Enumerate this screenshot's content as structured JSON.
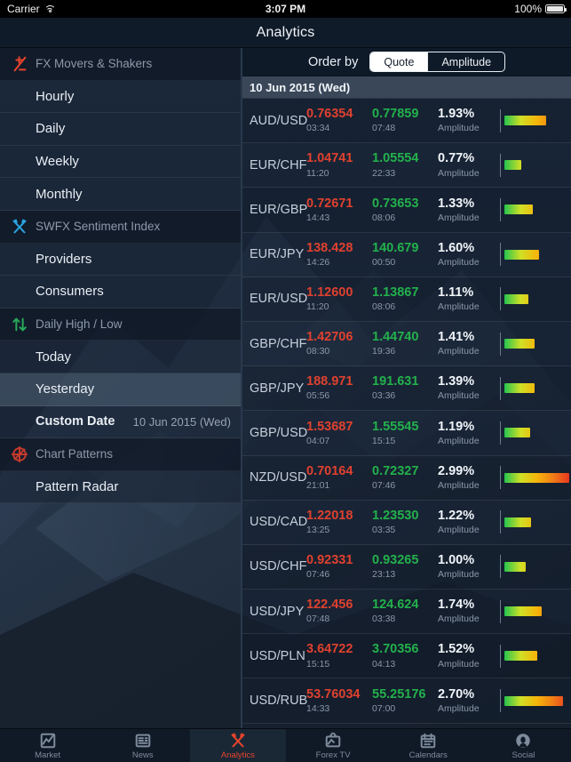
{
  "status_bar": {
    "carrier": "Carrier",
    "wifi_icon": "wifi-icon",
    "time": "3:07 PM",
    "battery_percent": "100%",
    "battery_icon": "battery-full-icon"
  },
  "navbar": {
    "title": "Analytics"
  },
  "sidebar": {
    "sections": [
      {
        "icon": "plus-minus-icon",
        "icon_color": "#e8442c",
        "label": "FX Movers & Shakers",
        "items": [
          {
            "label": "Hourly",
            "selected": false,
            "detail": ""
          },
          {
            "label": "Daily",
            "selected": false,
            "detail": ""
          },
          {
            "label": "Weekly",
            "selected": false,
            "detail": ""
          },
          {
            "label": "Monthly",
            "selected": false,
            "detail": ""
          }
        ]
      },
      {
        "icon": "crossed-tools-icon",
        "icon_color": "#2aa3e0",
        "label": "SWFX Sentiment Index",
        "items": [
          {
            "label": "Providers",
            "selected": false,
            "detail": ""
          },
          {
            "label": "Consumers",
            "selected": false,
            "detail": ""
          }
        ]
      },
      {
        "icon": "up-down-arrows-icon",
        "icon_color": "#29a85a",
        "label": "Daily High / Low",
        "items": [
          {
            "label": "Today",
            "selected": false,
            "detail": ""
          },
          {
            "label": "Yesterday",
            "selected": true,
            "detail": ""
          },
          {
            "label": "Custom Date",
            "selected": false,
            "detail": "10 Jun 2015 (Wed)"
          }
        ]
      },
      {
        "icon": "radar-target-icon",
        "icon_color": "#c33a2c",
        "label": "Chart Patterns",
        "items": [
          {
            "label": "Pattern Radar",
            "selected": false,
            "detail": ""
          }
        ]
      }
    ]
  },
  "main": {
    "order_by_label": "Order by",
    "order_by_options": [
      {
        "label": "Quote",
        "selected": true
      },
      {
        "label": "Amplitude",
        "selected": false
      }
    ],
    "date_header": "10 Jun 2015 (Wed)",
    "amplitude_caption": "Amplitude",
    "colors": {
      "low": "#e0412f",
      "high": "#23b14c",
      "bar_gradient_start": "#25c44f",
      "bar_gradient_end": "#e8381f",
      "accent": "#e8442c"
    },
    "rows": [
      {
        "pair": "AUD/USD",
        "low": "0.76354",
        "low_time": "03:34",
        "high": "0.77859",
        "high_time": "07:48",
        "amplitude": "1.93%",
        "amplitude_value": 1.93
      },
      {
        "pair": "EUR/CHF",
        "low": "1.04741",
        "low_time": "11:20",
        "high": "1.05554",
        "high_time": "22:33",
        "amplitude": "0.77%",
        "amplitude_value": 0.77
      },
      {
        "pair": "EUR/GBP",
        "low": "0.72671",
        "low_time": "14:43",
        "high": "0.73653",
        "high_time": "08:06",
        "amplitude": "1.33%",
        "amplitude_value": 1.33
      },
      {
        "pair": "EUR/JPY",
        "low": "138.428",
        "low_time": "14:26",
        "high": "140.679",
        "high_time": "00:50",
        "amplitude": "1.60%",
        "amplitude_value": 1.6
      },
      {
        "pair": "EUR/USD",
        "low": "1.12600",
        "low_time": "11:20",
        "high": "1.13867",
        "high_time": "08:06",
        "amplitude": "1.11%",
        "amplitude_value": 1.11
      },
      {
        "pair": "GBP/CHF",
        "low": "1.42706",
        "low_time": "08:30",
        "high": "1.44740",
        "high_time": "19:36",
        "amplitude": "1.41%",
        "amplitude_value": 1.41
      },
      {
        "pair": "GBP/JPY",
        "low": "188.971",
        "low_time": "05:56",
        "high": "191.631",
        "high_time": "03:36",
        "amplitude": "1.39%",
        "amplitude_value": 1.39
      },
      {
        "pair": "GBP/USD",
        "low": "1.53687",
        "low_time": "04:07",
        "high": "1.55545",
        "high_time": "15:15",
        "amplitude": "1.19%",
        "amplitude_value": 1.19
      },
      {
        "pair": "NZD/USD",
        "low": "0.70164",
        "low_time": "21:01",
        "high": "0.72327",
        "high_time": "07:46",
        "amplitude": "2.99%",
        "amplitude_value": 2.99
      },
      {
        "pair": "USD/CAD",
        "low": "1.22018",
        "low_time": "13:25",
        "high": "1.23530",
        "high_time": "03:35",
        "amplitude": "1.22%",
        "amplitude_value": 1.22
      },
      {
        "pair": "USD/CHF",
        "low": "0.92331",
        "low_time": "07:46",
        "high": "0.93265",
        "high_time": "23:13",
        "amplitude": "1.00%",
        "amplitude_value": 1.0
      },
      {
        "pair": "USD/JPY",
        "low": "122.456",
        "low_time": "07:48",
        "high": "124.624",
        "high_time": "03:38",
        "amplitude": "1.74%",
        "amplitude_value": 1.74
      },
      {
        "pair": "USD/PLN",
        "low": "3.64722",
        "low_time": "15:15",
        "high": "3.70356",
        "high_time": "04:13",
        "amplitude": "1.52%",
        "amplitude_value": 1.52
      },
      {
        "pair": "USD/RUB",
        "low": "53.76034",
        "low_time": "14:33",
        "high": "55.25176",
        "high_time": "07:00",
        "amplitude": "2.70%",
        "amplitude_value": 2.7
      }
    ]
  },
  "tabbar": {
    "items": [
      {
        "label": "Market",
        "icon": "chart-line-icon",
        "active": false
      },
      {
        "label": "News",
        "icon": "newspaper-icon",
        "active": false
      },
      {
        "label": "Analytics",
        "icon": "crossed-tools-icon",
        "active": true
      },
      {
        "label": "Forex TV",
        "icon": "television-icon",
        "active": false
      },
      {
        "label": "Calendars",
        "icon": "calendar-icon",
        "active": false
      },
      {
        "label": "Social",
        "icon": "person-icon",
        "active": false
      }
    ]
  }
}
